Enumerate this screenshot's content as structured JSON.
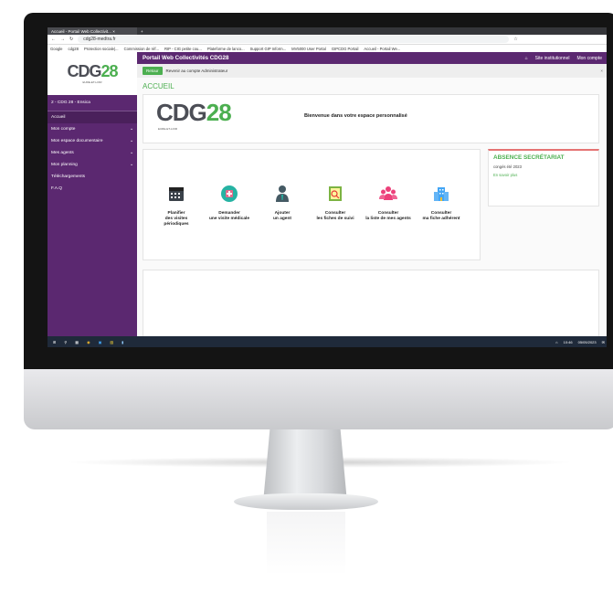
{
  "browser": {
    "tab_title": "Accueil - Portail Web Collectivit... ×",
    "new_tab": "+",
    "address": "cdg28-medtra.fr",
    "bookmarks": [
      "Google",
      "cdg28",
      "Protection sociale|...",
      "Commission de réf...",
      "RIP - CIG petite cou...",
      "Plateforme de lanco...",
      "Support GIP Inform...",
      "MV5000 User Portal",
      "GIPCDG Portail",
      "Accueil - Portail We..."
    ]
  },
  "app": {
    "brand": "Portail Web Collectivités CDG28",
    "top_links": [
      "Site institutionnel",
      "Mon compte"
    ],
    "notice": {
      "button": "Retour",
      "text": "Revenir au compte Administrateur",
      "close": "×"
    },
    "logo": {
      "text": "CDG",
      "accent": "28",
      "subtitle": "EURE-ET-LOIR"
    },
    "sidebar": {
      "user": "2 - CDG 28 - Ensica",
      "items": [
        {
          "label": "Accueil",
          "icon": "home-icon",
          "chevron": ""
        },
        {
          "label": "Mon compte",
          "icon": "user-icon",
          "chevron": "⌄"
        },
        {
          "label": "Mon espace documentaire",
          "icon": "folder-icon",
          "chevron": "⌄"
        },
        {
          "label": "Mes agents",
          "icon": "people-icon",
          "chevron": "⌄"
        },
        {
          "label": "Mon planning",
          "icon": "calendar-icon",
          "chevron": "⌄"
        },
        {
          "label": "Téléchargements",
          "icon": "download-icon",
          "chevron": ""
        },
        {
          "label": "F.A.Q",
          "icon": "faq-icon",
          "chevron": ""
        }
      ]
    },
    "page_title": "ACCUEIL",
    "welcome": "Bienvenue dans votre espace personnalisé",
    "actions": [
      {
        "line1": "Planifier",
        "line2": "des visites",
        "line3": "périodiques",
        "icon": "calendar-icon"
      },
      {
        "line1": "Demander",
        "line2": "une visite médicale",
        "line3": "",
        "icon": "medical-calendar-icon"
      },
      {
        "line1": "Ajouter",
        "line2": "un agent",
        "line3": "",
        "icon": "add-agent-icon"
      },
      {
        "line1": "Consulter",
        "line2": "les fiches de suivi",
        "line3": "",
        "icon": "followup-sheet-icon"
      },
      {
        "line1": "Consulter",
        "line2": "la liste de mes agents",
        "line3": "",
        "icon": "agents-list-icon"
      },
      {
        "line1": "Consulter",
        "line2": "ma fiche adhérent",
        "line3": "",
        "icon": "member-sheet-icon"
      }
    ],
    "absence": {
      "title": "ABSENCE SECRÉTARIAT",
      "text": "congés été 2023",
      "link": "En savoir plus"
    }
  },
  "taskbar": {
    "time": "10:46",
    "date": "05/05/2023"
  },
  "colors": {
    "brand_purple": "#5b2870",
    "accent_green": "#4caf50",
    "alert_red": "#e57373"
  }
}
